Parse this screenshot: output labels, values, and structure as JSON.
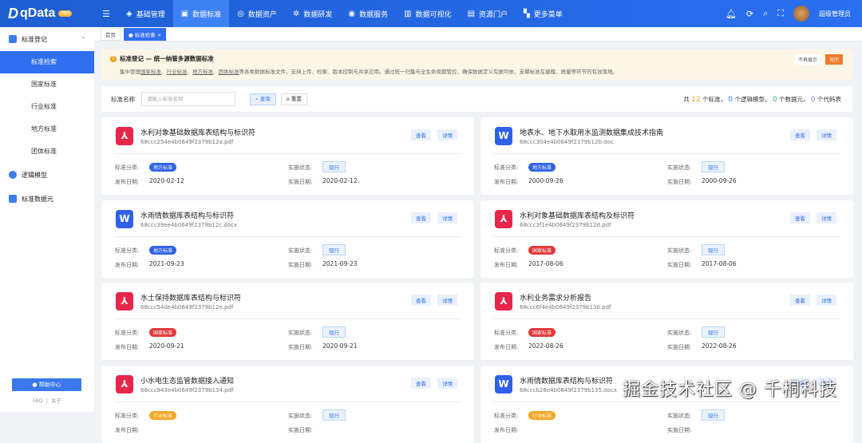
{
  "app": {
    "name": "qData",
    "badge": "PRO"
  },
  "nav": [
    {
      "label": "基础管理",
      "icon": "cube-icon"
    },
    {
      "label": "数据标准",
      "icon": "book-icon",
      "active": true
    },
    {
      "label": "数据资产",
      "icon": "target-icon"
    },
    {
      "label": "数据研发",
      "icon": "gear-icon"
    },
    {
      "label": "数据服务",
      "icon": "service-icon"
    },
    {
      "label": "数据可视化",
      "icon": "chart-icon"
    },
    {
      "label": "资源门户",
      "icon": "portal-icon"
    },
    {
      "label": "更多菜单",
      "icon": "grid-icon"
    }
  ],
  "user": {
    "name": "超级管理员"
  },
  "sidebar": {
    "group1": "标准登记",
    "subs": [
      "标准检索",
      "国家标准",
      "行业标准",
      "地方标准",
      "团体标准"
    ],
    "group2": "逻辑模型",
    "group3": "标准数据元",
    "help": "帮助中心",
    "faq": "FAQ",
    "sep": "|",
    "about": "关于"
  },
  "tabs": {
    "home": "首页",
    "active": "标准检索"
  },
  "banner": {
    "title": "标准登记 — 统一纳管多源数据标准",
    "pre": "集中管理",
    "l1": "国家标准",
    "s1": "、",
    "l2": "行业标准",
    "s2": "、",
    "l3": "地方标准",
    "s3": "、",
    "l4": "团体标准",
    "post": "等各类数据标准文件，支持上传、检索、版本控制与共享应用。通过统一归集与全生命周期管控，确保数据定义有据可依，支撑标准在建模、质量等环节的有效落地。",
    "no_show": "不再展示",
    "close": "关闭"
  },
  "search": {
    "label": "标准名称",
    "placeholder": "请输入标准名称",
    "query": "查询",
    "reset": "重置"
  },
  "stats": {
    "p0": "共",
    "n1": "12",
    "p1": "个标准，",
    "n2": "0",
    "p2": "个逻辑模型，",
    "n3": "0",
    "p3": "个数据元，",
    "n4": "0",
    "p4": "个代码表"
  },
  "labels": {
    "view": "查看",
    "detail": "详情",
    "category": "标准分类:",
    "status": "实施状态:",
    "publish": "发布日期:",
    "impl": "实施日期:"
  },
  "colors": {
    "地方标准": "#2f62e8",
    "国家标准": "#e03a3a",
    "行业标准": "#f5a623"
  },
  "cards": [
    {
      "title": "水利对象基础数据库表结构与标识符",
      "file": "68ccc254e4b0649f2379b12a.pdf",
      "type": "pdf",
      "category": "地方标准",
      "status": "现行",
      "publish": "2020-02-12",
      "impl": "2020-02-12"
    },
    {
      "title": "地表水、地下水取用水监测数据集成技术指南",
      "file": "68ccc304e4b0649f2379b12b.doc",
      "type": "doc",
      "category": "地方标准",
      "status": "现行",
      "publish": "2000-09-26",
      "impl": "2000-09-26"
    },
    {
      "title": "水雨情数据库表结构与标识符",
      "file": "68ccc39ee4b0649f2379b12c.docx",
      "type": "doc",
      "category": "地方标准",
      "status": "现行",
      "publish": "2021-09-23",
      "impl": "2021-09-23"
    },
    {
      "title": "水利对象基础数据库表结构及标识符",
      "file": "68ccc3f1e4b0649f2379b12d.pdf",
      "type": "pdf",
      "category": "国家标准",
      "status": "现行",
      "publish": "2017-08-06",
      "impl": "2017-08-06"
    },
    {
      "title": "水土保持数据库表结构与标识符",
      "file": "68ccc54de4b0649f2379b12e.pdf",
      "type": "pdf",
      "category": "国家标准",
      "status": "现行",
      "publish": "2020-09-21",
      "impl": "2020-09-21"
    },
    {
      "title": "水利业务需求分析报告",
      "file": "68ccc6f4e4b0649f2379b130.pdf",
      "type": "pdf",
      "category": "国家标准",
      "status": "现行",
      "publish": "2022-08-26",
      "impl": "2022-08-26"
    },
    {
      "title": "小水电生态监管数据接入通知",
      "file": "68ccc943e4b0649f2379b134.pdf",
      "type": "pdf",
      "category": "行业标准",
      "status": "现行",
      "publish": "",
      "impl": ""
    },
    {
      "title": "水雨情数据库表结构与标识符",
      "file": "68cccb28e4b0649f2379b135.docx",
      "type": "doc",
      "category": "行业标准",
      "status": "现行",
      "publish": "",
      "impl": ""
    }
  ],
  "watermark": "掘金技术社区 @ 千桐科技"
}
